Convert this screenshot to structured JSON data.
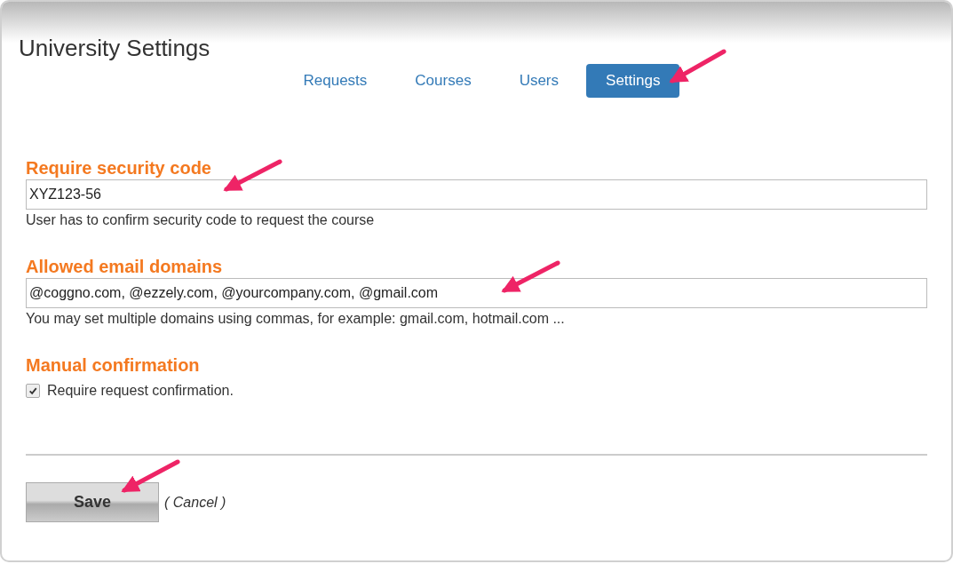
{
  "page": {
    "title": "University Settings"
  },
  "tabs": [
    {
      "label": "Requests",
      "selected": false
    },
    {
      "label": "Courses",
      "selected": false
    },
    {
      "label": "Users",
      "selected": false
    },
    {
      "label": "Settings",
      "selected": true
    }
  ],
  "fields": [
    {
      "kind": "text",
      "label": "Require security code",
      "value": "XYZ123-56",
      "help": "User has to confirm security code to request the course"
    },
    {
      "kind": "text",
      "label": "Allowed email domains",
      "value": "@coggno.com, @ezzely.com, @yourcompany.com, @gmail.com",
      "help": "You may set multiple domains using commas, for example: gmail.com, hotmail.com ..."
    },
    {
      "kind": "checkbox",
      "label": "Manual confirmation",
      "option": "Require request confirmation.",
      "checked": true
    }
  ],
  "actions": {
    "save": "Save",
    "cancel": "( Cancel )"
  }
}
